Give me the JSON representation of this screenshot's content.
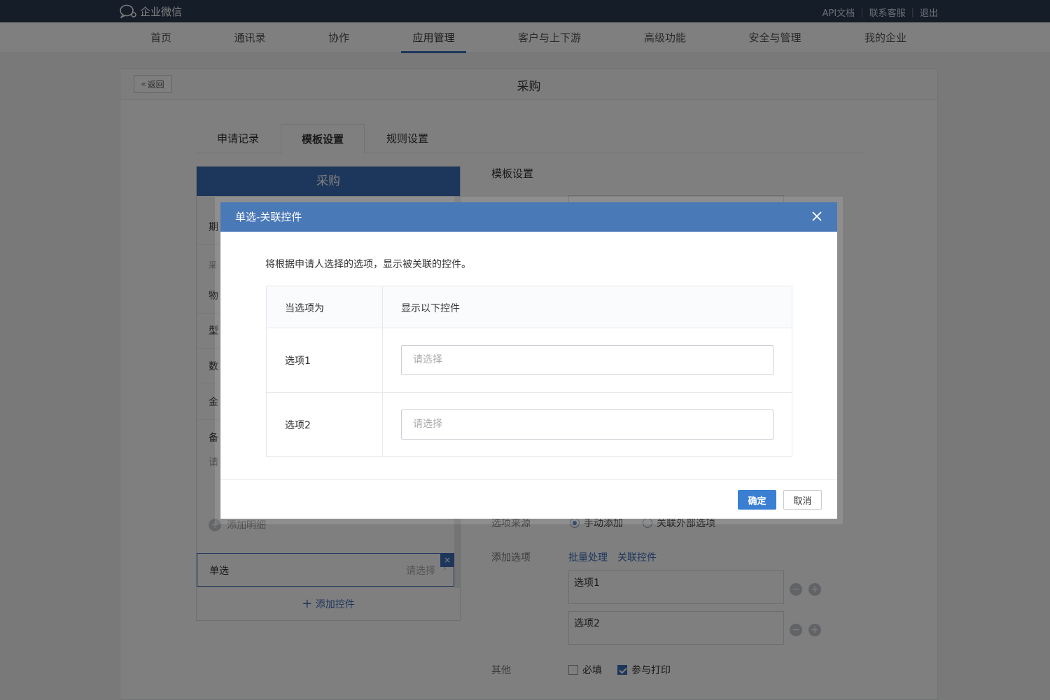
{
  "topbar": {
    "logo_text": "企业微信",
    "links": [
      "API文档",
      "联系客服",
      "退出"
    ]
  },
  "nav": {
    "items": [
      "首页",
      "通讯录",
      "协作",
      "应用管理",
      "客户与上下游",
      "高级功能",
      "安全与管理",
      "我的企业"
    ],
    "active_index": 3
  },
  "panel": {
    "back_label": "返回",
    "title": "采购",
    "tabs": [
      "申请记录",
      "模板设置",
      "规则设置"
    ],
    "active_tab": 1
  },
  "preview": {
    "header": "采购",
    "rows": [
      "期",
      "物",
      "型",
      "数",
      "金",
      "备"
    ],
    "sub_label": "采",
    "remark_hint": "请",
    "add_detail": "添加明细",
    "single_label": "单选",
    "single_value": "请选择",
    "add_control": "添加控件"
  },
  "settings": {
    "title": "模板设置",
    "option_source_label": "选项来源",
    "source_manual": "手动添加",
    "source_external": "关联外部选项",
    "add_options_label": "添加选项",
    "batch_link": "批量处理",
    "link_control": "关联控件",
    "options": [
      "选项1",
      "选项2"
    ],
    "other_label": "其他",
    "required_label": "必填",
    "print_label": "参与打印"
  },
  "modal": {
    "title": "单选-关联控件",
    "description": "将根据申请人选择的选项，显示被关联的控件。",
    "col_when": "当选项为",
    "col_show": "显示以下控件",
    "rows": [
      {
        "option": "选项1",
        "placeholder": "请选择"
      },
      {
        "option": "选项2",
        "placeholder": "请选择"
      }
    ],
    "confirm": "确定",
    "cancel": "取消"
  }
}
